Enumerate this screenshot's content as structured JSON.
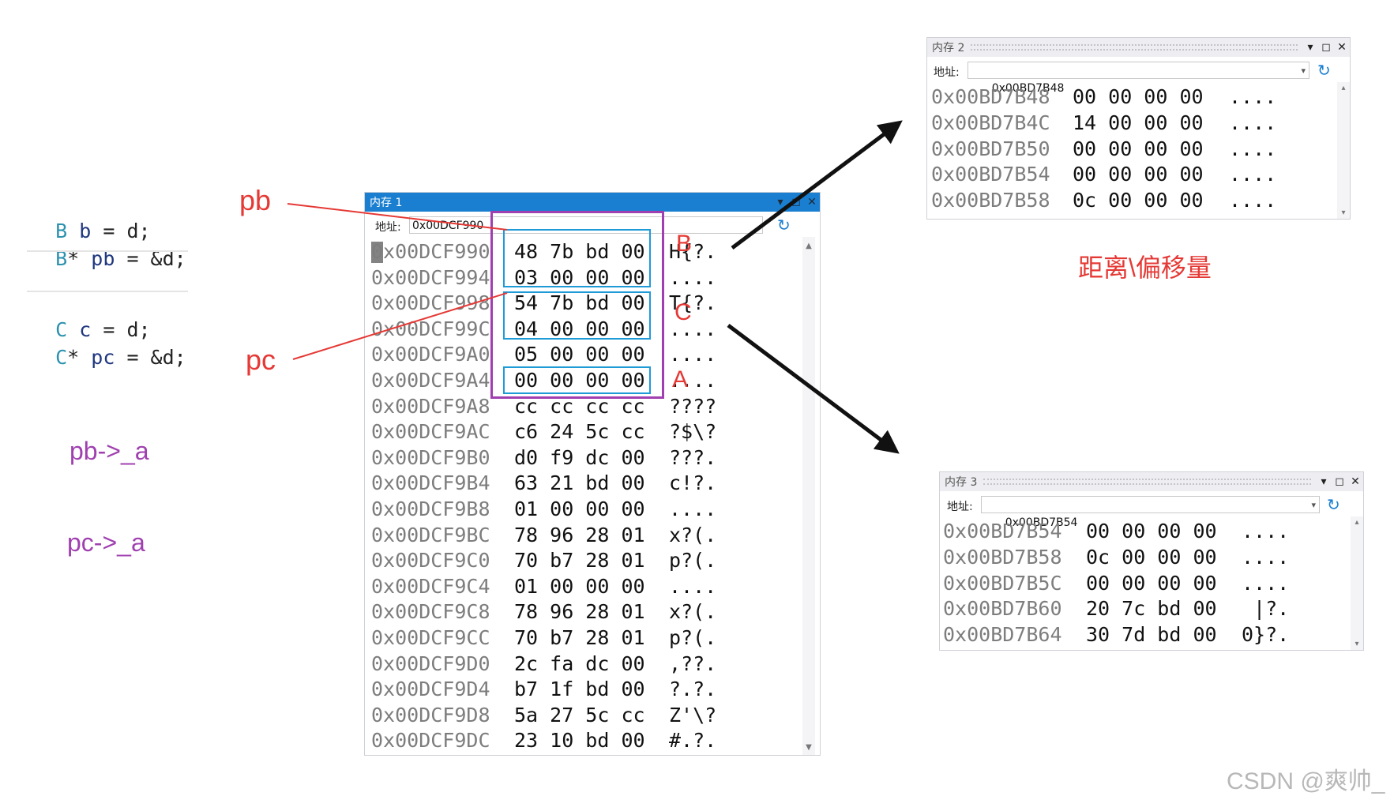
{
  "code": {
    "group1": [
      {
        "type": "B",
        "ptr": " ",
        "var": "b",
        "rest": " = d;"
      },
      {
        "type": "B",
        "ptr": "* ",
        "var": "pb",
        "rest": " = &d;"
      }
    ],
    "group2": [
      {
        "type": "C",
        "ptr": " ",
        "var": "c",
        "rest": " = d;"
      },
      {
        "type": "C",
        "ptr": "* ",
        "var": "pc",
        "rest": " = &d;"
      }
    ]
  },
  "annotations": {
    "pb_label": "pb",
    "pc_label": "pc",
    "pb_access": "pb->_a",
    "pc_access": "pc->_a",
    "box_label_b": "B",
    "box_label_c": "C",
    "box_label_a": "A",
    "offset_label": "距离\\偏移量"
  },
  "colors": {
    "annotation_red": "#e53935",
    "annotation_purple": "#a040b0",
    "box_blue": "#1e9bd7",
    "active_title_blue": "#1a7fd0"
  },
  "memory_windows": [
    {
      "title": "内存 1",
      "address_label": "地址:",
      "address_value": "0x00DCF990",
      "rows": [
        {
          "addr": "0x00DCF990",
          "bytes": "48 7b bd 00",
          "ascii": "H{?."
        },
        {
          "addr": "0x00DCF994",
          "bytes": "03 00 00 00",
          "ascii": "...."
        },
        {
          "addr": "0x00DCF998",
          "bytes": "54 7b bd 00",
          "ascii": "T{?."
        },
        {
          "addr": "0x00DCF99C",
          "bytes": "04 00 00 00",
          "ascii": "...."
        },
        {
          "addr": "0x00DCF9A0",
          "bytes": "05 00 00 00",
          "ascii": "...."
        },
        {
          "addr": "0x00DCF9A4",
          "bytes": "00 00 00 00",
          "ascii": "...."
        },
        {
          "addr": "0x00DCF9A8",
          "bytes": "cc cc cc cc",
          "ascii": "????"
        },
        {
          "addr": "0x00DCF9AC",
          "bytes": "c6 24 5c cc",
          "ascii": "?$\\?"
        },
        {
          "addr": "0x00DCF9B0",
          "bytes": "d0 f9 dc 00",
          "ascii": "???."
        },
        {
          "addr": "0x00DCF9B4",
          "bytes": "63 21 bd 00",
          "ascii": "c!?."
        },
        {
          "addr": "0x00DCF9B8",
          "bytes": "01 00 00 00",
          "ascii": "...."
        },
        {
          "addr": "0x00DCF9BC",
          "bytes": "78 96 28 01",
          "ascii": "x?(."
        },
        {
          "addr": "0x00DCF9C0",
          "bytes": "70 b7 28 01",
          "ascii": "p?(."
        },
        {
          "addr": "0x00DCF9C4",
          "bytes": "01 00 00 00",
          "ascii": "...."
        },
        {
          "addr": "0x00DCF9C8",
          "bytes": "78 96 28 01",
          "ascii": "x?(."
        },
        {
          "addr": "0x00DCF9CC",
          "bytes": "70 b7 28 01",
          "ascii": "p?(."
        },
        {
          "addr": "0x00DCF9D0",
          "bytes": "2c fa dc 00",
          "ascii": ",??."
        },
        {
          "addr": "0x00DCF9D4",
          "bytes": "b7 1f bd 00",
          "ascii": "?.?."
        },
        {
          "addr": "0x00DCF9D8",
          "bytes": "5a 27 5c cc",
          "ascii": "Z'\\?"
        },
        {
          "addr": "0x00DCF9DC",
          "bytes": "23 10 bd 00",
          "ascii": "#.?."
        }
      ]
    },
    {
      "title": "内存 2",
      "address_label": "地址:",
      "address_value": "0x00BD7B48",
      "rows": [
        {
          "addr": "0x00BD7B48",
          "bytes": "00 00 00 00",
          "ascii": "...."
        },
        {
          "addr": "0x00BD7B4C",
          "bytes": "14 00 00 00",
          "ascii": "...."
        },
        {
          "addr": "0x00BD7B50",
          "bytes": "00 00 00 00",
          "ascii": "...."
        },
        {
          "addr": "0x00BD7B54",
          "bytes": "00 00 00 00",
          "ascii": "...."
        },
        {
          "addr": "0x00BD7B58",
          "bytes": "0c 00 00 00",
          "ascii": "...."
        }
      ]
    },
    {
      "title": "内存 3",
      "address_label": "地址:",
      "address_value": "0x00BD7B54",
      "rows": [
        {
          "addr": "0x00BD7B54",
          "bytes": "00 00 00 00",
          "ascii": "...."
        },
        {
          "addr": "0x00BD7B58",
          "bytes": "0c 00 00 00",
          "ascii": "...."
        },
        {
          "addr": "0x00BD7B5C",
          "bytes": "00 00 00 00",
          "ascii": "...."
        },
        {
          "addr": "0x00BD7B60",
          "bytes": "20 7c bd 00",
          "ascii": " |?."
        },
        {
          "addr": "0x00BD7B64",
          "bytes": "30 7d bd 00",
          "ascii": "0}?."
        }
      ]
    }
  ],
  "icons": {
    "title_bar": [
      "chevron-down-icon",
      "maximize-icon",
      "close-icon"
    ],
    "address_bar": [
      "dropdown-icon",
      "refresh-icon"
    ]
  },
  "watermark": "CSDN @爽帅_"
}
